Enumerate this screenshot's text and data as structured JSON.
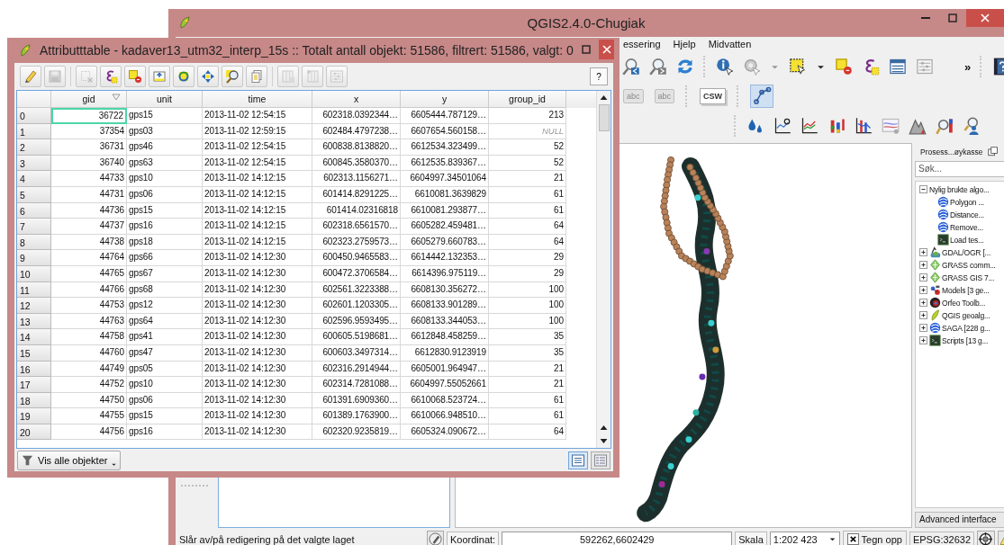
{
  "main_window": {
    "title": "QGIS2.4.0-Chugiak",
    "menu": [
      "essering",
      "Hjelp",
      "Midvatten"
    ],
    "toolbar": {
      "overflow": "»",
      "label_tools": [
        "abc",
        "abc"
      ],
      "csw": "CSW",
      "profile_tool_active": true
    },
    "processing": {
      "title": "Prosess...øykasse",
      "search_placeholder": "Søk...",
      "tree": [
        {
          "label": "Nylig brukte algo...",
          "kind": "folder",
          "expanded": true,
          "children": [
            {
              "label": "Polygon ...",
              "kind": "saga"
            },
            {
              "label": "Distance...",
              "kind": "saga"
            },
            {
              "label": "Remove...",
              "kind": "saga"
            },
            {
              "label": "Load tes...",
              "kind": "script"
            }
          ]
        },
        {
          "label": "GDAL/OGR [...",
          "kind": "gdal",
          "expanded": false
        },
        {
          "label": "GRASS comm...",
          "kind": "grass",
          "expanded": false
        },
        {
          "label": "GRASS GIS 7...",
          "kind": "grass",
          "expanded": false
        },
        {
          "label": "Models [3 ge...",
          "kind": "model",
          "expanded": false
        },
        {
          "label": "Orfeo Toolb...",
          "kind": "otb",
          "expanded": false
        },
        {
          "label": "QGIS geoalg...",
          "kind": "qgis",
          "expanded": false
        },
        {
          "label": "SAGA [228 g...",
          "kind": "saga",
          "expanded": false
        },
        {
          "label": "Scripts [13 g...",
          "kind": "script",
          "expanded": false
        }
      ],
      "mode": "Advanced interface"
    },
    "status_bar": {
      "message": "Slår av/på redigering på det valgte laget",
      "coordinate_label": "Koordinat:",
      "coordinate": "592262,6602429",
      "scale_label": "Skala",
      "scale": "1:202 423",
      "render": {
        "label": "Tegn opp",
        "checked": true
      },
      "crs": "EPSG:32632"
    }
  },
  "attribute_window": {
    "title": "Attributttable - kadaver13_utm32_interp_15s :: Totalt antall objekt: 51586, filtrert: 51586, valgt: 0",
    "help": "?",
    "columns": [
      "gid",
      "unit",
      "time",
      "x",
      "y",
      "group_id"
    ],
    "rows": [
      {
        "id": "0",
        "current": true,
        "group_id_null": false,
        "cells": [
          "36722",
          "gps15",
          "2013-11-02 12:54:15",
          "602318.0392344…",
          "6605444.787129…",
          "213"
        ]
      },
      {
        "id": "1",
        "current": false,
        "group_id_null": true,
        "cells": [
          "37354",
          "gps03",
          "2013-11-02 12:59:15",
          "602484.4797238…",
          "6607654.560158…",
          "NULL"
        ]
      },
      {
        "id": "2",
        "current": false,
        "group_id_null": false,
        "cells": [
          "36731",
          "gps46",
          "2013-11-02 12:54:15",
          "600838.8138820…",
          "6612534.323499…",
          "52"
        ]
      },
      {
        "id": "3",
        "current": false,
        "group_id_null": false,
        "cells": [
          "36740",
          "gps63",
          "2013-11-02 12:54:15",
          "600845.3580370…",
          "6612535.839367…",
          "52"
        ]
      },
      {
        "id": "4",
        "current": false,
        "group_id_null": false,
        "cells": [
          "44733",
          "gps10",
          "2013-11-02 14:12:15",
          "602313.1156271…",
          "6604997.34501064",
          "21"
        ]
      },
      {
        "id": "5",
        "current": false,
        "group_id_null": false,
        "cells": [
          "44731",
          "gps06",
          "2013-11-02 14:12:15",
          "601414.8291225…",
          "6610081.3639829",
          "61"
        ]
      },
      {
        "id": "6",
        "current": false,
        "group_id_null": false,
        "cells": [
          "44736",
          "gps15",
          "2013-11-02 14:12:15",
          "601414.02316818",
          "6610081.293877…",
          "61"
        ]
      },
      {
        "id": "7",
        "current": false,
        "group_id_null": false,
        "cells": [
          "44737",
          "gps16",
          "2013-11-02 14:12:15",
          "602318.6561570…",
          "6605282.459481…",
          "64"
        ]
      },
      {
        "id": "8",
        "current": false,
        "group_id_null": false,
        "cells": [
          "44738",
          "gps18",
          "2013-11-02 14:12:15",
          "602323.2759573…",
          "6605279.660783…",
          "64"
        ]
      },
      {
        "id": "9",
        "current": false,
        "group_id_null": false,
        "cells": [
          "44764",
          "gps66",
          "2013-11-02 14:12:30",
          "600450.9465583…",
          "6614442.132353…",
          "29"
        ]
      },
      {
        "id": "10",
        "current": false,
        "group_id_null": false,
        "cells": [
          "44765",
          "gps67",
          "2013-11-02 14:12:30",
          "600472.3706584…",
          "6614396.975119…",
          "29"
        ]
      },
      {
        "id": "11",
        "current": false,
        "group_id_null": false,
        "cells": [
          "44766",
          "gps68",
          "2013-11-02 14:12:30",
          "602561.3223388…",
          "6608130.356272…",
          "100"
        ]
      },
      {
        "id": "12",
        "current": false,
        "group_id_null": false,
        "cells": [
          "44753",
          "gps12",
          "2013-11-02 14:12:30",
          "602601.1203305…",
          "6608133.901289…",
          "100"
        ]
      },
      {
        "id": "13",
        "current": false,
        "group_id_null": false,
        "cells": [
          "44763",
          "gps64",
          "2013-11-02 14:12:30",
          "602596.9593495…",
          "6608133.344053…",
          "100"
        ]
      },
      {
        "id": "14",
        "current": false,
        "group_id_null": false,
        "cells": [
          "44758",
          "gps41",
          "2013-11-02 14:12:30",
          "600605.5198681…",
          "6612848.458259…",
          "35"
        ]
      },
      {
        "id": "15",
        "current": false,
        "group_id_null": false,
        "cells": [
          "44760",
          "gps47",
          "2013-11-02 14:12:30",
          "600603.3497314…",
          "6612830.9123919",
          "35"
        ]
      },
      {
        "id": "16",
        "current": false,
        "group_id_null": false,
        "cells": [
          "44749",
          "gps05",
          "2013-11-02 14:12:30",
          "602316.2914944…",
          "6605001.964947…",
          "21"
        ]
      },
      {
        "id": "17",
        "current": false,
        "group_id_null": false,
        "cells": [
          "44752",
          "gps10",
          "2013-11-02 14:12:30",
          "602314.7281088…",
          "6604997.55052661",
          "21"
        ]
      },
      {
        "id": "18",
        "current": false,
        "group_id_null": false,
        "cells": [
          "44750",
          "gps06",
          "2013-11-02 14:12:30",
          "601391.6909360…",
          "6610068.523724…",
          "61"
        ]
      },
      {
        "id": "19",
        "current": false,
        "group_id_null": false,
        "cells": [
          "44755",
          "gps15",
          "2013-11-02 14:12:30",
          "601389.1763900…",
          "6610066.948510…",
          "61"
        ]
      },
      {
        "id": "20",
        "current": false,
        "group_id_null": false,
        "cells": [
          "44756",
          "gps16",
          "2013-11-02 14:12:30",
          "602320.9235819…",
          "6605324.090672…",
          "64"
        ]
      }
    ],
    "filter_button": "Vis alle objekter"
  }
}
